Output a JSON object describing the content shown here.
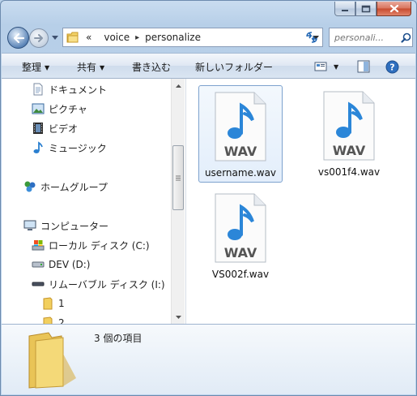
{
  "window": {
    "title": "personalize"
  },
  "caption": {
    "minimize": "minimize",
    "maximize": "maximize",
    "close": "close"
  },
  "address": {
    "prefix": "«",
    "crumbs": [
      "voice",
      "personalize"
    ],
    "separator": "▸"
  },
  "search": {
    "placeholder": "personali..."
  },
  "toolbar": {
    "organize": "整理",
    "share": "共有",
    "burn": "書き込む",
    "new_folder": "新しいフォルダー"
  },
  "nav": {
    "items": [
      {
        "label": "ドキュメント",
        "icon": "document-icon"
      },
      {
        "label": "ピクチャ",
        "icon": "picture-icon"
      },
      {
        "label": "ビデオ",
        "icon": "video-icon"
      },
      {
        "label": "ミュージック",
        "icon": "music-icon"
      },
      {
        "label": "ホームグループ",
        "icon": "homegroup-icon"
      },
      {
        "label": "コンピューター",
        "icon": "computer-icon"
      },
      {
        "label": "ローカル ディスク (C:)",
        "icon": "local-disk-icon"
      },
      {
        "label": "DEV (D:)",
        "icon": "drive-icon"
      },
      {
        "label": "リムーバブル ディスク (I:)",
        "icon": "removable-drive-icon"
      },
      {
        "label": "1",
        "icon": "folder-icon"
      },
      {
        "label": "2",
        "icon": "folder-icon"
      }
    ]
  },
  "files": [
    {
      "name": "username.wav",
      "badge": "WAV",
      "selected": true
    },
    {
      "name": "vs001f4.wav",
      "badge": "WAV",
      "selected": false
    },
    {
      "name": "VS002f.wav",
      "badge": "WAV",
      "selected": false
    }
  ],
  "details": {
    "count_text": "3 個の項目"
  },
  "colors": {
    "accent": "#3a8fd9",
    "selection_border": "#7da2ce",
    "window_frame": "#b9d1ea"
  }
}
